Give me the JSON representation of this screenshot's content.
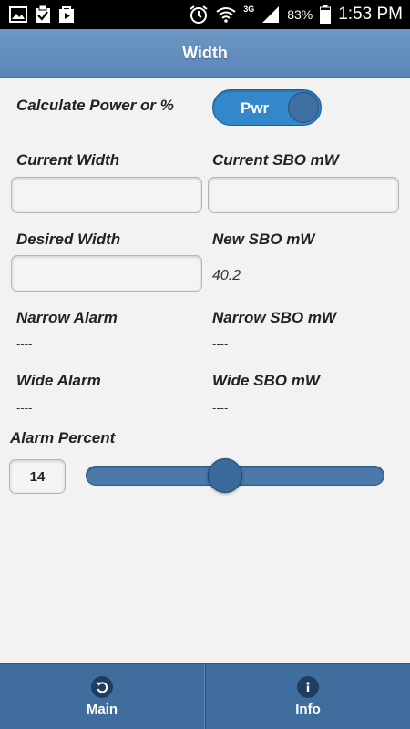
{
  "status_bar": {
    "battery_pct": "83%",
    "network": "3G",
    "time": "1:53 PM"
  },
  "header": {
    "title": "Width"
  },
  "form": {
    "calc_label": "Calculate Power or %",
    "toggle_label": "Pwr",
    "current_width_label": "Current Width",
    "current_width_value": "",
    "current_sbo_label": "Current SBO mW",
    "current_sbo_value": "",
    "desired_width_label": "Desired Width",
    "desired_width_value": "",
    "new_sbo_label": "New SBO mW",
    "new_sbo_value": "40.2",
    "narrow_alarm_label": "Narrow Alarm",
    "narrow_alarm_value": "----",
    "narrow_sbo_label": "Narrow SBO mW",
    "narrow_sbo_value": "----",
    "wide_alarm_label": "Wide Alarm",
    "wide_alarm_value": "----",
    "wide_sbo_label": "Wide SBO mW",
    "wide_sbo_value": "----",
    "alarm_percent_label": "Alarm Percent",
    "alarm_percent_value": "14",
    "alarm_percent_slider": {
      "value": 14,
      "min": 0,
      "max": 30
    }
  },
  "nav": {
    "main_label": "Main",
    "main_icon": "undo-icon",
    "info_label": "Info",
    "info_icon": "info-icon"
  },
  "colors": {
    "header": "#5f8cbb",
    "accent": "#3388cc",
    "nav_bar": "#3f6d9e"
  }
}
